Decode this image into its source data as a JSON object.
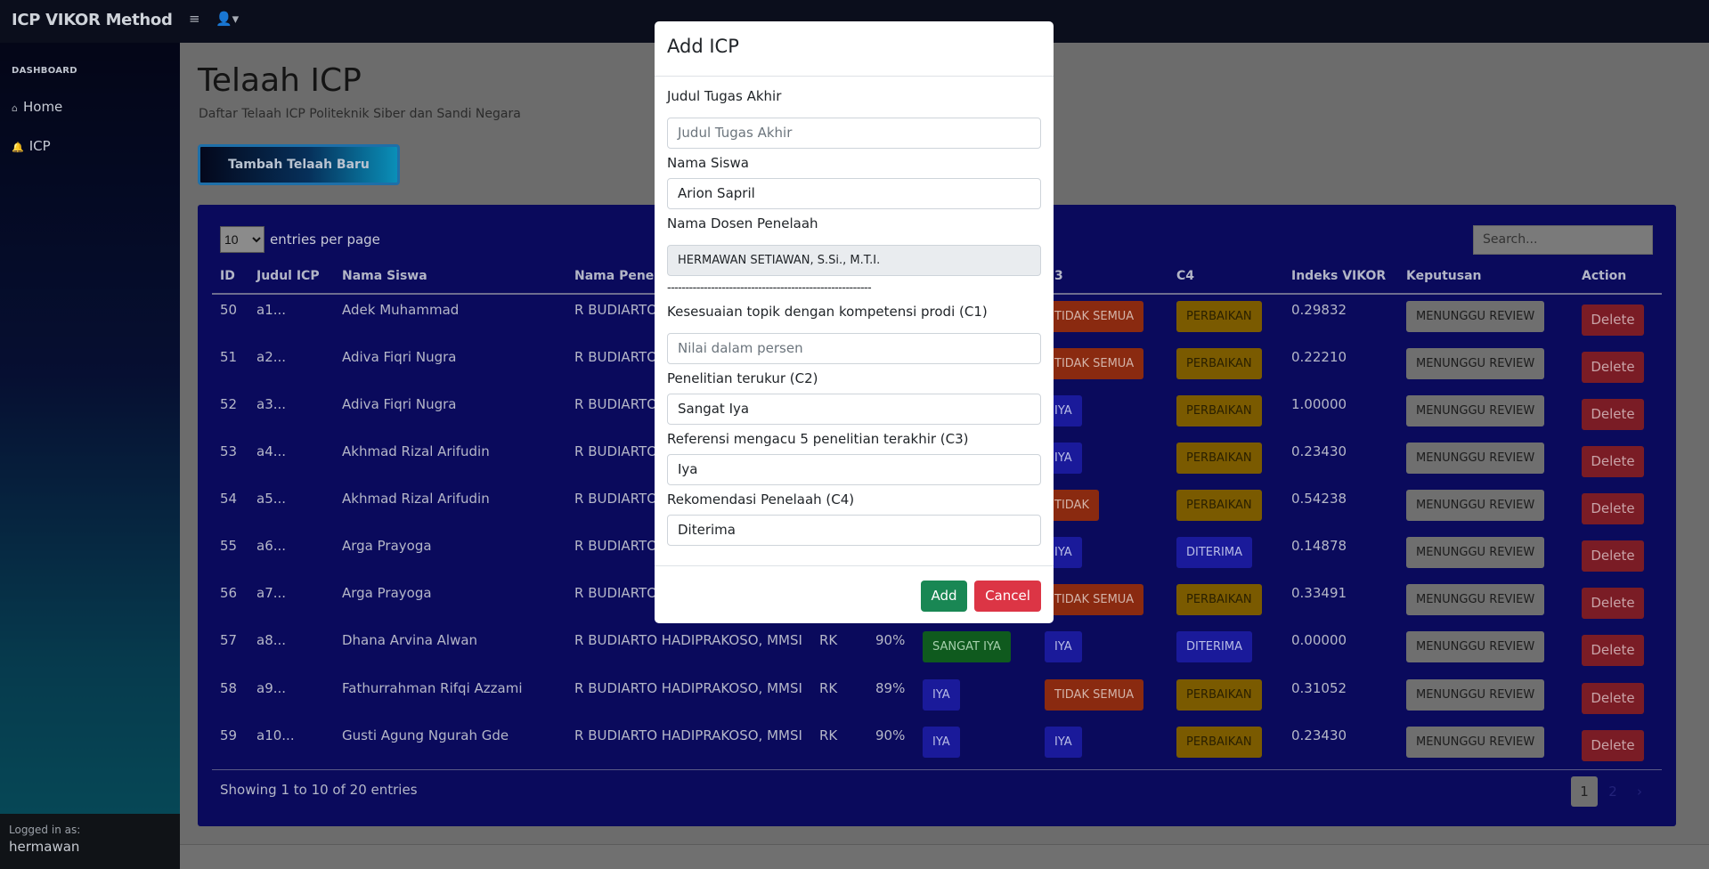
{
  "app": {
    "brand": "ICP VIKOR Method"
  },
  "navbar": {
    "menu_icon": "hamburger-icon",
    "user_icon": "user-icon"
  },
  "sidebar": {
    "heading": "DASHBOARD",
    "items": [
      {
        "label": "Home",
        "icon": "home-icon"
      },
      {
        "label": "ICP",
        "icon": "bell-icon"
      }
    ],
    "footer": {
      "logged_in_label": "Logged in as:",
      "username": "hermawan"
    }
  },
  "page": {
    "title": "Telaah ICP",
    "subtitle": "Daftar Telaah ICP Politeknik Siber dan Sandi Negara",
    "add_button": "Tambah Telaah Baru"
  },
  "table": {
    "entries_value": "10",
    "entries_label": "entries per page",
    "search_placeholder": "Search...",
    "headers": [
      "ID",
      "Judul ICP",
      "Nama Siswa",
      "Nama Penel",
      "3",
      "C4",
      "Indeks VIKOR",
      "Keputusan",
      "Action"
    ],
    "rows": [
      {
        "id": "50",
        "judul": "a1...",
        "siswa": "Adek Muhammad",
        "penelaah": "R BUDIARTO I",
        "c3": "TIDAK SEMUA",
        "c4": "PERBAIKAN",
        "vikor": "0.29832",
        "keputusan": "MENUNGGU REVIEW",
        "action": "Delete"
      },
      {
        "id": "51",
        "judul": "a2...",
        "siswa": "Adiva Fiqri Nugra",
        "penelaah": "R BUDIARTO I",
        "c3": "TIDAK SEMUA",
        "c4": "PERBAIKAN",
        "vikor": "0.22210",
        "keputusan": "MENUNGGU REVIEW",
        "action": "Delete"
      },
      {
        "id": "52",
        "judul": "a3...",
        "siswa": "Adiva Fiqri Nugra",
        "penelaah": "R BUDIARTO I",
        "c3": "IYA",
        "c4": "PERBAIKAN",
        "vikor": "1.00000",
        "keputusan": "MENUNGGU REVIEW",
        "action": "Delete"
      },
      {
        "id": "53",
        "judul": "a4...",
        "siswa": "Akhmad Rizal Arifudin",
        "penelaah": "R BUDIARTO I",
        "c3": "IYA",
        "c4": "PERBAIKAN",
        "vikor": "0.23430",
        "keputusan": "MENUNGGU REVIEW",
        "action": "Delete"
      },
      {
        "id": "54",
        "judul": "a5...",
        "siswa": "Akhmad Rizal Arifudin",
        "penelaah": "R BUDIARTO I",
        "c3": "TIDAK",
        "c4": "PERBAIKAN",
        "vikor": "0.54238",
        "keputusan": "MENUNGGU REVIEW",
        "action": "Delete"
      },
      {
        "id": "55",
        "judul": "a6...",
        "siswa": "Arga Prayoga",
        "penelaah": "R BUDIARTO I",
        "c3": "IYA",
        "c4": "DITERIMA",
        "vikor": "0.14878",
        "keputusan": "MENUNGGU REVIEW",
        "action": "Delete"
      },
      {
        "id": "56",
        "judul": "a7...",
        "siswa": "Arga Prayoga",
        "penelaah": "R BUDIARTO I",
        "c3": "TIDAK SEMUA",
        "c4": "PERBAIKAN",
        "vikor": "0.33491",
        "keputusan": "MENUNGGU REVIEW",
        "action": "Delete"
      },
      {
        "id": "57",
        "judul": "a8...",
        "siswa": "Dhana Arvina Alwan",
        "penelaah": "R BUDIARTO HADIPRAKOSO, MMSI",
        "kode": "RK",
        "c1": "90%",
        "c2": "SANGAT IYA",
        "c3": "IYA",
        "c4": "DITERIMA",
        "vikor": "0.00000",
        "keputusan": "MENUNGGU REVIEW",
        "action": "Delete"
      },
      {
        "id": "58",
        "judul": "a9...",
        "siswa": "Fathurrahman Rifqi Azzami",
        "penelaah": "R BUDIARTO HADIPRAKOSO, MMSI",
        "kode": "RK",
        "c1": "89%",
        "c2": "IYA",
        "c3": "TIDAK SEMUA",
        "c4": "PERBAIKAN",
        "vikor": "0.31052",
        "keputusan": "MENUNGGU REVIEW",
        "action": "Delete"
      },
      {
        "id": "59",
        "judul": "a10...",
        "siswa": "Gusti Agung Ngurah Gde",
        "penelaah": "R BUDIARTO HADIPRAKOSO, MMSI",
        "kode": "RK",
        "c1": "90%",
        "c2": "IYA",
        "c3": "IYA",
        "c4": "PERBAIKAN",
        "vikor": "0.23430",
        "keputusan": "MENUNGGU REVIEW",
        "action": "Delete"
      }
    ],
    "showing": "Showing 1 to 10 of 20 entries",
    "pages": [
      "1",
      "2",
      "›"
    ]
  },
  "modal": {
    "title": "Add ICP",
    "judul_label": "Judul Tugas Akhir",
    "judul_placeholder": "Judul Tugas Akhir",
    "siswa_label": "Nama Siswa",
    "siswa_value": "Arion Sapril",
    "dosen_label": "Nama Dosen Penelaah",
    "dosen_value": "HERMAWAN SETIAWAN, S.Si., M.T.I.",
    "divider": "--------------------------------------------------------",
    "c1_label": "Kesesuaian topik dengan kompetensi prodi (C1)",
    "c1_placeholder": "Nilai dalam persen",
    "c2_label": "Penelitian terukur (C2)",
    "c2_value": "Sangat Iya",
    "c3_label": "Referensi mengacu 5 penelitian terakhir (C3)",
    "c3_value": "Iya",
    "c4_label": "Rekomendasi Penelaah (C4)",
    "c4_value": "Diterima",
    "add_button": "Add",
    "cancel_button": "Cancel"
  },
  "colors": {
    "modal_add": "#198754",
    "modal_cancel": "#dc3545",
    "card_bg": "#0a0a5c"
  }
}
